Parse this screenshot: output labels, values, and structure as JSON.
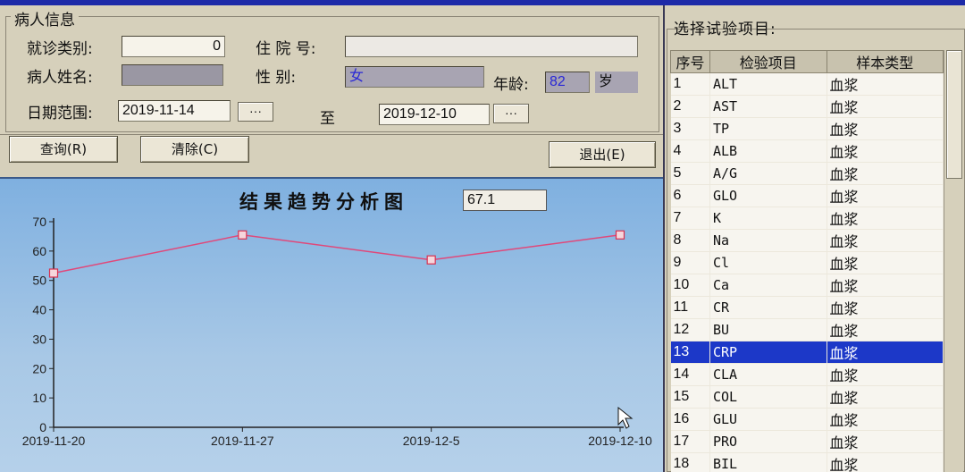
{
  "patient_info": {
    "legend": "病人信息",
    "visit_type_label": "就诊类别:",
    "visit_type_value": "0",
    "admission_no_label": "住 院 号:",
    "admission_no_value": "",
    "patient_name_label": "病人姓名:",
    "patient_name_value": "",
    "sex_label": "性  别:",
    "sex_value": "女",
    "age_label": "年龄:",
    "age_value": "82",
    "age_unit": "岁",
    "date_range_label": "日期范围:",
    "date_from": "2019-11-14",
    "date_to_label": "至",
    "date_to": "2019-12-10",
    "date_picker_label": "···"
  },
  "buttons": {
    "query": "查询(R)",
    "clear": "清除(C)",
    "exit": "退出(E)"
  },
  "chart_header": {
    "title": "结果趋势分析图",
    "current_value": "67.1"
  },
  "colors": {
    "line": "#e0487a",
    "selected_row": "#1c38c8",
    "chart_bg": "#9fc3e6"
  },
  "chart_data": {
    "type": "line",
    "title": "结果趋势分析图",
    "xlabel": "",
    "ylabel": "",
    "x": [
      "2019-11-20",
      "2019-11-27",
      "2019-12-5",
      "2019-12-10"
    ],
    "values": [
      52.5,
      65.5,
      57,
      65.5
    ],
    "ylim": [
      0,
      70
    ],
    "yticks": [
      0,
      10,
      20,
      30,
      40,
      50,
      60,
      70
    ],
    "grid": false
  },
  "test_panel": {
    "legend": "选择试验项目:",
    "columns": [
      "序号",
      "检验项目",
      "样本类型"
    ],
    "selected_index": 12,
    "rows": [
      {
        "no": "1",
        "item": "ALT",
        "sample": "血浆"
      },
      {
        "no": "2",
        "item": "AST",
        "sample": "血浆"
      },
      {
        "no": "3",
        "item": "TP",
        "sample": "血浆"
      },
      {
        "no": "4",
        "item": "ALB",
        "sample": "血浆"
      },
      {
        "no": "5",
        "item": "A/G",
        "sample": "血浆"
      },
      {
        "no": "6",
        "item": "GLO",
        "sample": "血浆"
      },
      {
        "no": "7",
        "item": "K",
        "sample": "血浆"
      },
      {
        "no": "8",
        "item": "Na",
        "sample": "血浆"
      },
      {
        "no": "9",
        "item": "Cl",
        "sample": "血浆"
      },
      {
        "no": "10",
        "item": "Ca",
        "sample": "血浆"
      },
      {
        "no": "11",
        "item": "CR",
        "sample": "血浆"
      },
      {
        "no": "12",
        "item": "BU",
        "sample": "血浆"
      },
      {
        "no": "13",
        "item": "CRP",
        "sample": "血浆"
      },
      {
        "no": "14",
        "item": "CLA",
        "sample": "血浆"
      },
      {
        "no": "15",
        "item": "COL",
        "sample": "血浆"
      },
      {
        "no": "16",
        "item": "GLU",
        "sample": "血浆"
      },
      {
        "no": "17",
        "item": "PRO",
        "sample": "血浆"
      },
      {
        "no": "18",
        "item": "BIL",
        "sample": "血浆"
      }
    ]
  }
}
